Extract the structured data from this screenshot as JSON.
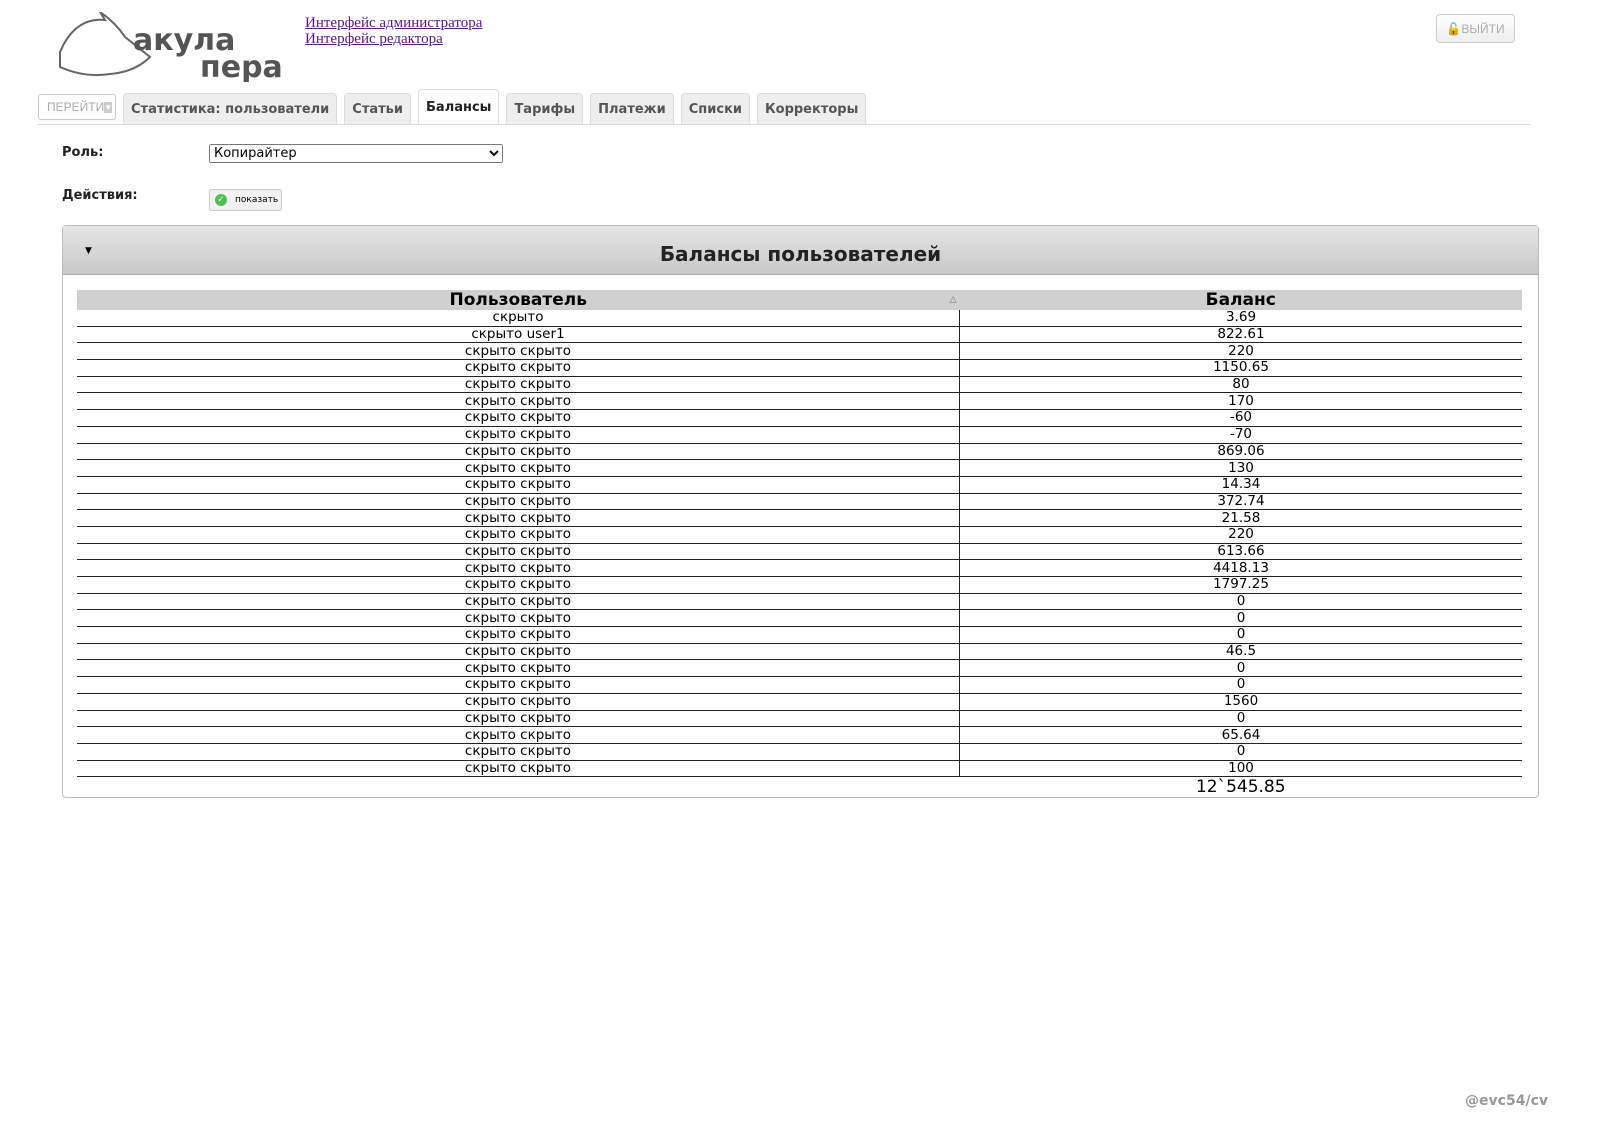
{
  "header": {
    "logo_text": "акула пера",
    "links": [
      "Интерфейс администратора",
      "Интерфейс редактора"
    ],
    "logout_label": "ВЫЙТИ"
  },
  "nav": {
    "goto_label": "ПЕРЕЙТИ",
    "tabs": [
      "Статистика: пользователи",
      "Статьи",
      "Балансы",
      "Тарифы",
      "Платежи",
      "Списки",
      "Корректоры"
    ],
    "active_tab": "Балансы"
  },
  "form": {
    "role_label": "Роль:",
    "role_value": "Копирайтер",
    "actions_label": "Действия:",
    "show_button": "показать"
  },
  "panel": {
    "title": "Балансы пользователей",
    "columns": [
      "Пользователь",
      "Баланс"
    ],
    "rows": [
      [
        "скрыто",
        "3.69"
      ],
      [
        "скрыто user1",
        "822.61"
      ],
      [
        "скрыто скрыто",
        "220"
      ],
      [
        "скрыто скрыто",
        "1150.65"
      ],
      [
        "скрыто скрыто",
        "80"
      ],
      [
        "скрыто скрыто",
        "170"
      ],
      [
        "скрыто скрыто",
        "-60"
      ],
      [
        "скрыто скрыто",
        "-70"
      ],
      [
        "скрыто скрыто",
        "869.06"
      ],
      [
        "скрыто скрыто",
        "130"
      ],
      [
        "скрыто скрыто",
        "14.34"
      ],
      [
        "скрыто скрыто",
        "372.74"
      ],
      [
        "скрыто скрыто",
        "21.58"
      ],
      [
        "скрыто скрыто",
        "220"
      ],
      [
        "скрыто скрыто",
        "613.66"
      ],
      [
        "скрыто скрыто",
        "4418.13"
      ],
      [
        "скрыто скрыто",
        "1797.25"
      ],
      [
        "скрыто скрыто",
        "0"
      ],
      [
        "скрыто скрыто",
        "0"
      ],
      [
        "скрыто скрыто",
        "0"
      ],
      [
        "скрыто скрыто",
        "46.5"
      ],
      [
        "скрыто скрыто",
        "0"
      ],
      [
        "скрыто скрыто",
        "0"
      ],
      [
        "скрыто скрыто",
        "1560"
      ],
      [
        "скрыто скрыто",
        "0"
      ],
      [
        "скрыто скрыто",
        "65.64"
      ],
      [
        "скрыто скрыто",
        "0"
      ],
      [
        "скрыто скрыто",
        "100"
      ]
    ],
    "total": "12`545.85"
  },
  "watermark": "@evc54/cv"
}
